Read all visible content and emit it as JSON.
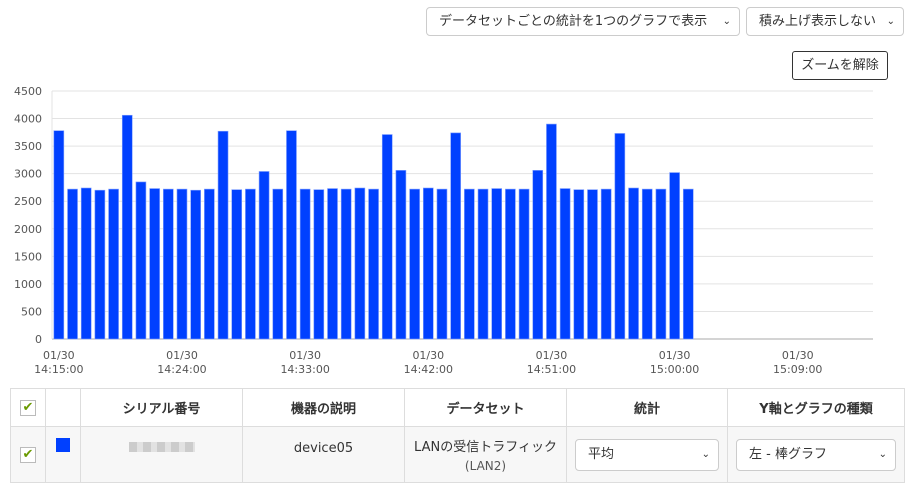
{
  "controls": {
    "display_mode": "データセットごとの統計を1つのグラフで表示",
    "stack_mode": "積み上げ表示しない",
    "zoom_reset": "ズームを解除"
  },
  "chart_data": {
    "type": "bar",
    "x_unit": "minute",
    "x_start": "01/30 14:15:00",
    "x_range": [
      "01/30 14:14:30",
      "01/30 15:14:30"
    ],
    "x_ticks": [
      [
        "01/30",
        "14:15:00"
      ],
      [
        "01/30",
        "14:24:00"
      ],
      [
        "01/30",
        "14:33:00"
      ],
      [
        "01/30",
        "14:42:00"
      ],
      [
        "01/30",
        "14:51:00"
      ],
      [
        "01/30",
        "15:00:00"
      ],
      [
        "01/30",
        "15:09:00"
      ]
    ],
    "y_ticks": [
      "0",
      "500",
      "1000",
      "1500",
      "2000",
      "2500",
      "3000",
      "3500",
      "4000",
      "4500"
    ],
    "ylim": [
      0,
      4500
    ],
    "grid": true,
    "color": "#0040ff",
    "values": [
      3780,
      2720,
      2740,
      2700,
      2720,
      4060,
      2850,
      2730,
      2720,
      2720,
      2700,
      2720,
      3770,
      2710,
      2720,
      3040,
      2720,
      3780,
      2720,
      2710,
      2730,
      2720,
      2740,
      2720,
      3710,
      3060,
      2720,
      2740,
      2720,
      3740,
      2720,
      2720,
      2730,
      2720,
      2720,
      3060,
      3900,
      2730,
      2710,
      2710,
      2720,
      3730,
      2740,
      2720,
      2720,
      3020,
      2720
    ]
  },
  "table": {
    "headers": [
      "シリアル番号",
      "機器の説明",
      "データセット",
      "統計",
      "Y軸とグラフの種類"
    ],
    "rows": [
      {
        "checked": true,
        "color": "#0040ff",
        "description": "device05",
        "dataset": "LANの受信トラフィック",
        "dataset_sub": "(LAN2)",
        "statistic": "平均",
        "axis_type": "左 - 棒グラフ"
      }
    ]
  }
}
